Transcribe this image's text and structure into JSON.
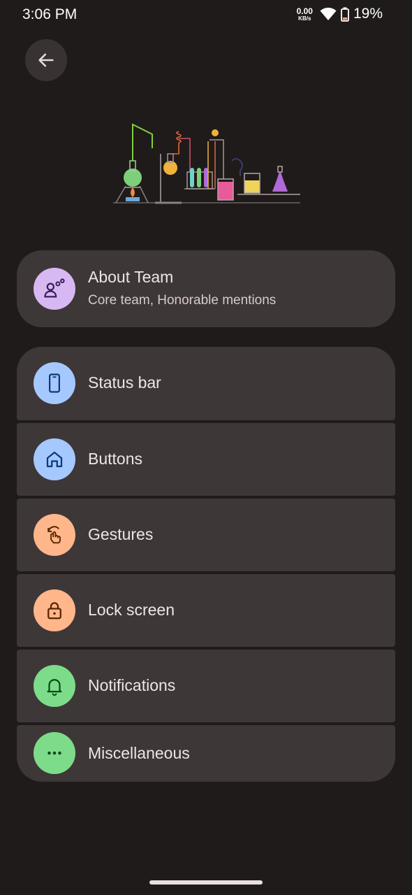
{
  "status_bar": {
    "time": "3:06 PM",
    "net_speed_value": "0.00",
    "net_speed_unit": "KB/s",
    "battery": "19%",
    "icons": [
      "wifi-icon",
      "battery-icon"
    ]
  },
  "header": {
    "back_icon": "arrow-left-icon"
  },
  "about": {
    "title": "About Team",
    "subtitle": "Core team, Honorable mentions",
    "icon": "team-icon",
    "color": "#d7b8f3"
  },
  "menu": [
    {
      "label": "Status bar",
      "icon": "phone-icon",
      "color": "#a5c8ff"
    },
    {
      "label": "Buttons",
      "icon": "home-icon",
      "color": "#a5c8ff"
    },
    {
      "label": "Gestures",
      "icon": "gesture-icon",
      "color": "#ffb68a"
    },
    {
      "label": "Lock screen",
      "icon": "lock-icon",
      "color": "#ffb68a"
    },
    {
      "label": "Notifications",
      "icon": "bell-icon",
      "color": "#7ddc8a"
    },
    {
      "label": "Miscellaneous",
      "icon": "more-icon",
      "color": "#7ddc8a"
    }
  ]
}
